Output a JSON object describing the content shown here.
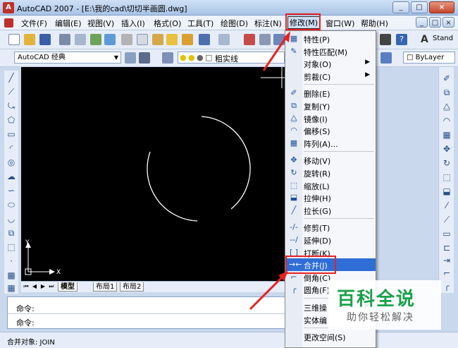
{
  "window": {
    "title": "AutoCAD 2007 - [E:\\我的cad\\切切半画圆.dwg]",
    "app_icon": "A",
    "controls": [
      "_",
      "□",
      "×"
    ],
    "doc_controls": [
      "_",
      "□",
      "×"
    ]
  },
  "menubar": {
    "items": [
      {
        "label": "文件(F)"
      },
      {
        "label": "编辑(E)"
      },
      {
        "label": "视图(V)"
      },
      {
        "label": "插入(I)"
      },
      {
        "label": "格式(O)"
      },
      {
        "label": "工具(T)"
      },
      {
        "label": "绘图(D)"
      },
      {
        "label": "标注(N)"
      },
      {
        "label": "修改(M)"
      },
      {
        "label": "窗口(W)"
      },
      {
        "label": "帮助(H)"
      }
    ],
    "active": "修改(M)"
  },
  "toolbar": {
    "workspace": "AutoCAD 经典",
    "layer_text": "粗实线",
    "style": "Stand",
    "linetype": "ByLayer"
  },
  "modify_menu": {
    "items": [
      {
        "label": "特性(P)",
        "icon": "properties-icon",
        "glyph": "▦"
      },
      {
        "label": "特性匹配(M)",
        "icon": "match-properties-icon",
        "glyph": "✎"
      },
      {
        "label": "对象(O)",
        "icon": "",
        "glyph": "",
        "submenu": true
      },
      {
        "label": "剪裁(C)",
        "icon": "",
        "glyph": "",
        "submenu": true
      },
      {
        "sep": true
      },
      {
        "label": "删除(E)",
        "icon": "erase-icon",
        "glyph": "✐"
      },
      {
        "label": "复制(Y)",
        "icon": "copy-icon",
        "glyph": "⧉"
      },
      {
        "label": "镜像(I)",
        "icon": "mirror-icon",
        "glyph": "⧋"
      },
      {
        "label": "偏移(S)",
        "icon": "offset-icon",
        "glyph": "◠"
      },
      {
        "label": "阵列(A)...",
        "icon": "array-icon",
        "glyph": "▦"
      },
      {
        "sep": true
      },
      {
        "label": "移动(V)",
        "icon": "move-icon",
        "glyph": "✥"
      },
      {
        "label": "旋转(R)",
        "icon": "rotate-icon",
        "glyph": "↻"
      },
      {
        "label": "缩放(L)",
        "icon": "scale-icon",
        "glyph": "⬚"
      },
      {
        "label": "拉伸(H)",
        "icon": "stretch-icon",
        "glyph": "⬓"
      },
      {
        "label": "拉长(G)",
        "icon": "lengthen-icon",
        "glyph": "╱"
      },
      {
        "sep": true
      },
      {
        "label": "修剪(T)",
        "icon": "trim-icon",
        "glyph": "-/-"
      },
      {
        "label": "延伸(D)",
        "icon": "extend-icon",
        "glyph": "--/"
      },
      {
        "label": "打断(K)",
        "icon": "break-icon",
        "glyph": "[ ]"
      },
      {
        "label": "合并(J)",
        "icon": "join-icon",
        "glyph": "→←",
        "highlight": true
      },
      {
        "label": "倒角(C)",
        "icon": "chamfer-icon",
        "glyph": "⌐"
      },
      {
        "label": "圆角(F)",
        "icon": "fillet-icon",
        "glyph": "╭"
      },
      {
        "sep": true
      },
      {
        "label": "三维操",
        "icon": "",
        "glyph": "",
        "submenu": true
      },
      {
        "label": "实体编",
        "icon": "",
        "glyph": "",
        "submenu": true
      },
      {
        "sep": true
      },
      {
        "label": "更改空间(S)",
        "icon": "",
        "glyph": ""
      }
    ]
  },
  "layout_tabs": [
    "模型",
    "布局1",
    "布局2"
  ],
  "axes": {
    "x": "X",
    "y": "Y"
  },
  "command": {
    "line1": "命令:",
    "line2": "命令:"
  },
  "status": {
    "text": "合并对象: JOIN"
  },
  "watermark": {
    "title": "百科全说",
    "subtitle": "助你轻松解决"
  },
  "colors": {
    "accent": "#2f6ed6",
    "annotation": "#e52222",
    "brand": "#1aa04a"
  }
}
